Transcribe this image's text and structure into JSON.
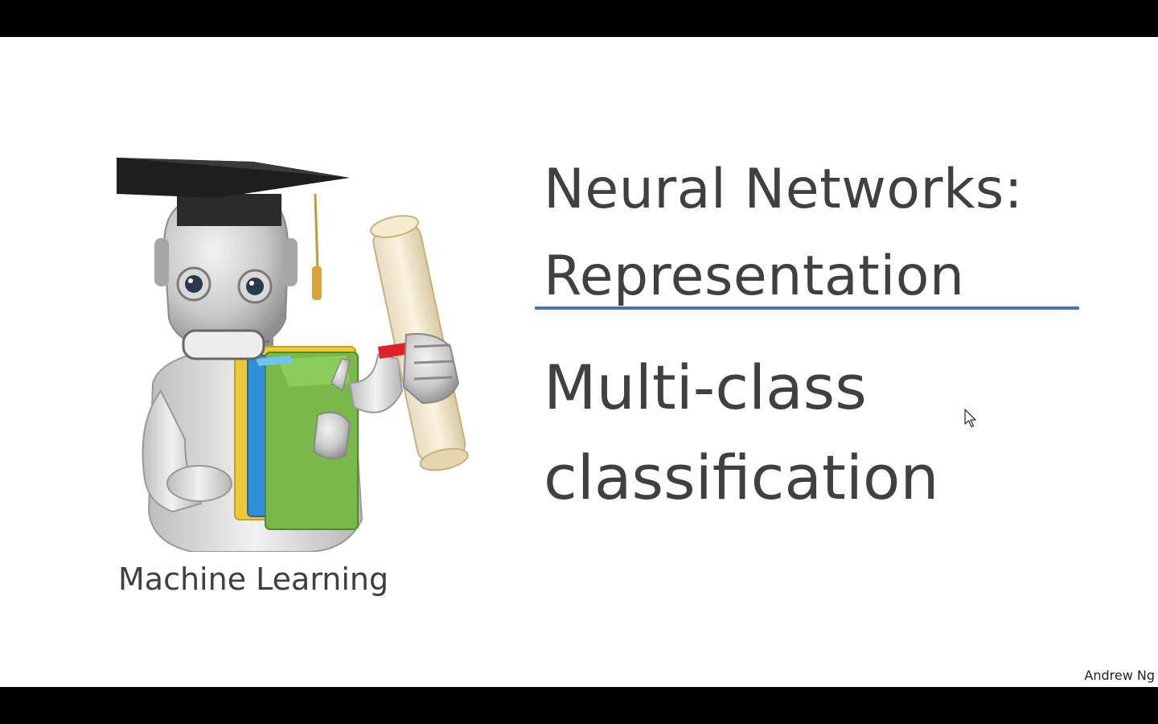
{
  "slide": {
    "title_line1": "Neural Networks:",
    "title_line2": "Representation",
    "subtitle_line1": "Multi-class",
    "subtitle_line2": "classification",
    "course_label": "Machine Learning",
    "author": "Andrew Ng"
  },
  "colors": {
    "divider": "#4f6fb4",
    "text": "#404040",
    "letterbox": "#000000",
    "background": "#ffffff"
  },
  "illustration": {
    "name": "graduate-robot-icon"
  },
  "pointer": {
    "name": "mouse-cursor-icon"
  }
}
